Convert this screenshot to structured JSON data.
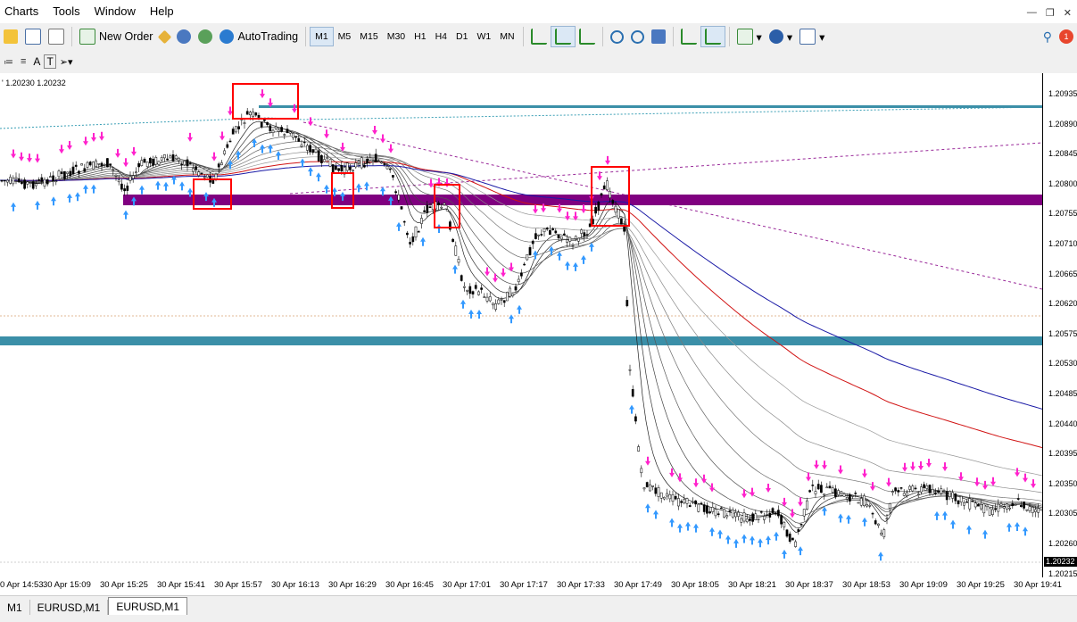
{
  "menu": [
    "Charts",
    "Tools",
    "Window",
    "Help"
  ],
  "toolbar": {
    "new_order": "New Order",
    "auto_trading": "AutoTrading",
    "timeframes": [
      "M1",
      "M5",
      "M15",
      "M30",
      "H1",
      "H4",
      "D1",
      "W1",
      "MN"
    ],
    "active_timeframe": "M1"
  },
  "chart": {
    "info_text": "' 1.20230 1.20232",
    "current_price": "1.20232",
    "price_labels": [
      "1.20935",
      "1.20890",
      "1.20845",
      "1.20800",
      "1.20755",
      "1.20710",
      "1.20665",
      "1.20620",
      "1.20575",
      "1.20530",
      "1.20485",
      "1.20440",
      "1.20395",
      "1.20350",
      "1.20305",
      "1.20260",
      "1.20215"
    ],
    "time_labels": [
      "0 Apr 14:53",
      "30 Apr 15:09",
      "30 Apr 15:25",
      "30 Apr 15:41",
      "30 Apr 15:57",
      "30 Apr 16:13",
      "30 Apr 16:29",
      "30 Apr 16:45",
      "30 Apr 17:01",
      "30 Apr 17:17",
      "30 Apr 17:33",
      "30 Apr 17:49",
      "30 Apr 18:05",
      "30 Apr 18:21",
      "30 Apr 18:37",
      "30 Apr 18:53",
      "30 Apr 19:09",
      "30 Apr 19:25",
      "30 Apr 19:41"
    ],
    "colors": {
      "purple_zone": "#800080",
      "teal_zone": "#3b8fa8",
      "up_arrow": "#3399ff",
      "down_arrow": "#ff22cc",
      "ema_slow_blue": "#1a1aa6",
      "ema_red": "#d11414",
      "box": "#ff0000"
    }
  },
  "tabs": [
    "M1",
    "EURUSD,M1",
    "EURUSD,M1"
  ],
  "active_tab": 2
}
